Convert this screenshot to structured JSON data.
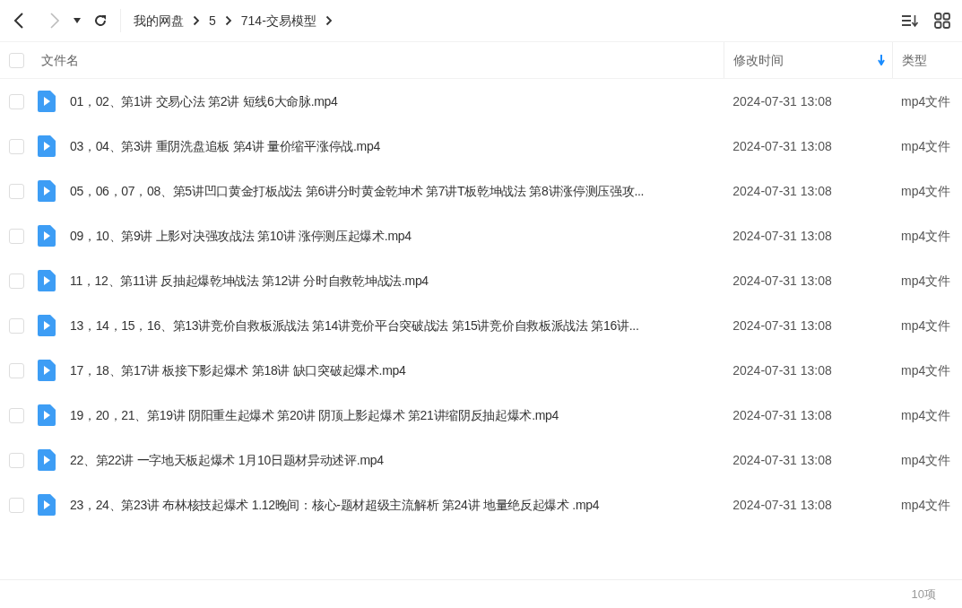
{
  "toolbar": {
    "forward_button": {
      "disabled": true
    },
    "breadcrumb": [
      {
        "label": "我的网盘"
      },
      {
        "label": "5"
      },
      {
        "label": "714-交易模型"
      }
    ]
  },
  "table": {
    "select_all": {
      "checked": false
    },
    "columns": [
      {
        "label": "文件名"
      },
      {
        "label": "修改时间",
        "sorted": true
      },
      {
        "label": "类型"
      }
    ],
    "rows": [
      {
        "checked": false,
        "name": "01，02、第1讲 交易心法  第2讲 短线6大命脉.mp4",
        "modified": "2024-07-31 13:08",
        "type": "mp4文件"
      },
      {
        "checked": false,
        "name": "03，04、第3讲 重阴洗盘追板  第4讲 量价缩平涨停战.mp4",
        "modified": "2024-07-31 13:08",
        "type": "mp4文件"
      },
      {
        "checked": false,
        "name": "05，06，07，08、第5讲凹口黄金打板战法 第6讲分时黄金乾坤术 第7讲T板乾坤战法 第8讲涨停测压强攻...",
        "modified": "2024-07-31 13:08",
        "type": "mp4文件"
      },
      {
        "checked": false,
        "name": "09，10、第9讲  上影对决强攻战法   第10讲  涨停测压起爆术.mp4",
        "modified": "2024-07-31 13:08",
        "type": "mp4文件"
      },
      {
        "checked": false,
        "name": "11，12、第11讲  反抽起爆乾坤战法    第12讲  分时自救乾坤战法.mp4",
        "modified": "2024-07-31 13:08",
        "type": "mp4文件"
      },
      {
        "checked": false,
        "name": "13，14，15，16、第13讲竞价自救板派战法 第14讲竞价平台突破战法 第15讲竞价自救板派战法 第16讲...",
        "modified": "2024-07-31 13:08",
        "type": "mp4文件"
      },
      {
        "checked": false,
        "name": "17，18、第17讲 板接下影起爆术  第18讲 缺口突破起爆术.mp4",
        "modified": "2024-07-31 13:08",
        "type": "mp4文件"
      },
      {
        "checked": false,
        "name": "19，20，21、第19讲 阴阳重生起爆术  第20讲 阴顶上影起爆术  第21讲缩阴反抽起爆术.mp4",
        "modified": "2024-07-31 13:08",
        "type": "mp4文件"
      },
      {
        "checked": false,
        "name": "22、第22讲 一字地天板起爆术  1月10日题材异动述评.mp4",
        "modified": "2024-07-31 13:08",
        "type": "mp4文件"
      },
      {
        "checked": false,
        "name": "23，24、第23讲 布林核技起爆术  1.12晚间：核心-题材超级主流解析  第24讲 地量绝反起爆术 .mp4",
        "modified": "2024-07-31 13:08",
        "type": "mp4文件"
      }
    ]
  },
  "status_bar": {
    "count": "10项"
  }
}
